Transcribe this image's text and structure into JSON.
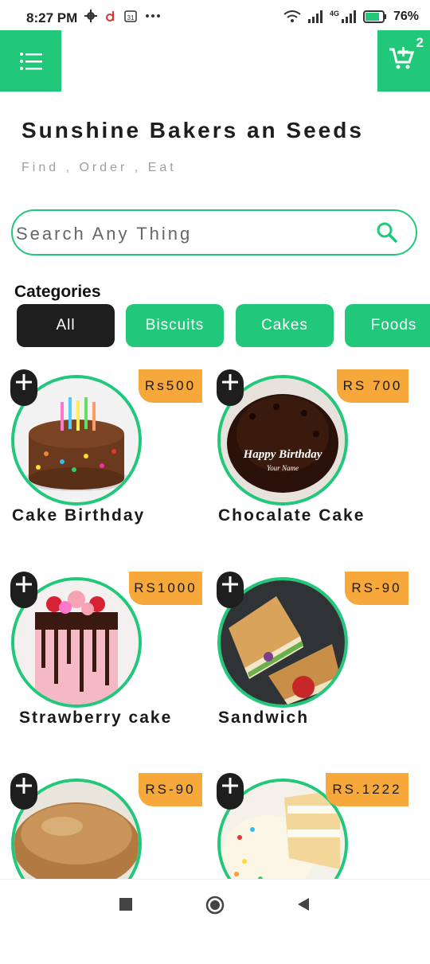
{
  "status_bar": {
    "time": "8:27 PM",
    "battery": "76%",
    "network": "4G"
  },
  "header": {
    "cart_count": "2",
    "title": "Sunshine Bakers an Seeds",
    "subtitle": "Find , Order , Eat"
  },
  "search": {
    "placeholder": "Search Any Thing"
  },
  "categories": {
    "label": "Categories",
    "items": [
      "All",
      "Biscuits",
      "Cakes",
      "Foods"
    ]
  },
  "products": [
    {
      "name": "Cake Birthday",
      "price": "Rs500"
    },
    {
      "name": "Chocalate Cake",
      "price": "RS 700"
    },
    {
      "name": "Strawberry cake",
      "price": "RS1000"
    },
    {
      "name": "Sandwich",
      "price": "RS-90"
    },
    {
      "name": "",
      "price": "RS-90"
    },
    {
      "name": "",
      "price": "RS.1222"
    }
  ],
  "colors": {
    "accent": "#22c87a",
    "price_tag": "#f7a83a",
    "dark": "#1e1e1e"
  },
  "icons": [
    "menu-list-icon",
    "cart-plus-icon",
    "search-icon",
    "plus-icon",
    "nav-square-icon",
    "nav-home-icon",
    "nav-back-icon"
  ]
}
